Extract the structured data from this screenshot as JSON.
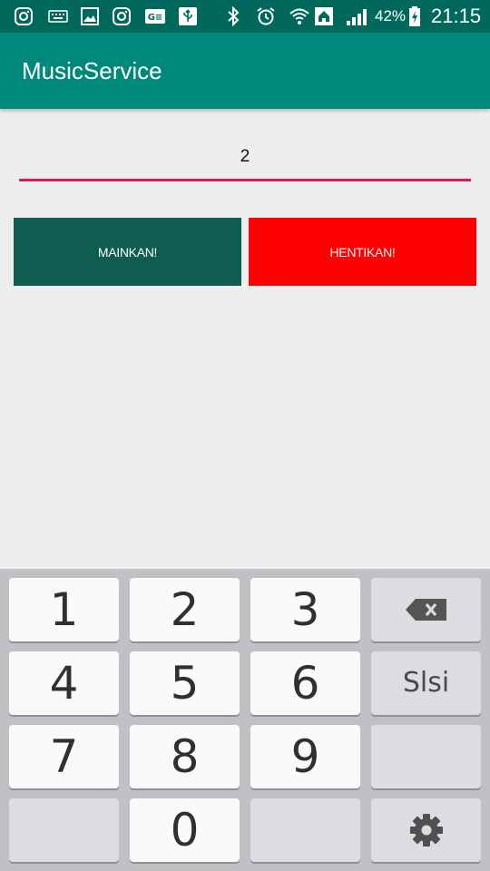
{
  "status_bar": {
    "icons": [
      "instagram-icon",
      "keyboard-icon",
      "image-icon",
      "instagram-icon",
      "ge-icon",
      "usb-icon",
      "bluetooth-icon",
      "alarm-icon",
      "wifi-icon",
      "signal-icon",
      "battery-charging-icon"
    ],
    "battery": "42%",
    "time": "21:15"
  },
  "app_bar": {
    "title": "MusicService"
  },
  "input": {
    "value": "2"
  },
  "buttons": {
    "play": "MAINKAN!",
    "stop": "HENTIKAN!"
  },
  "keyboard": {
    "keys": {
      "k1": "1",
      "k2": "2",
      "k3": "3",
      "k4": "4",
      "k5": "5",
      "k6": "6",
      "k7": "7",
      "k8": "8",
      "k9": "9",
      "k0": "0",
      "done": "Slsi"
    }
  },
  "colors": {
    "status_bar": "#00695c",
    "app_bar": "#00897b",
    "accent_underline": "#d81b60",
    "play_button": "#0f5c51",
    "stop_button": "#ff0000"
  }
}
